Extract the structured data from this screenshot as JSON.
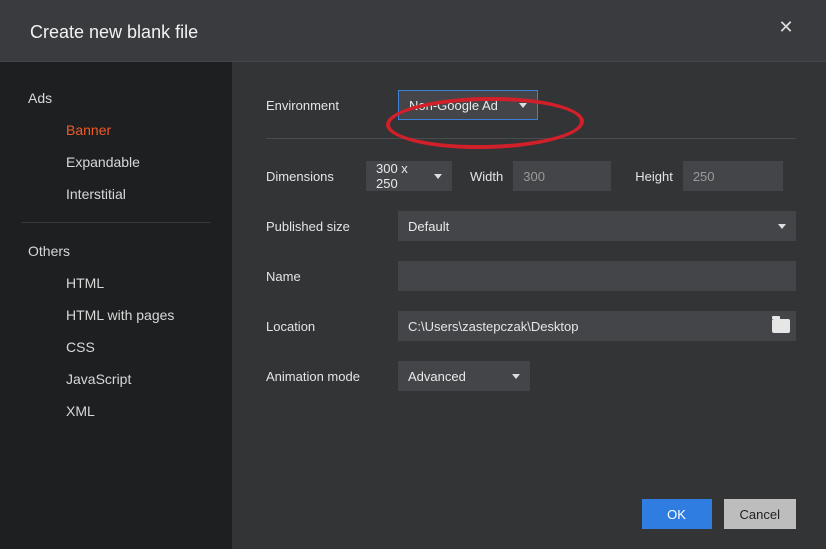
{
  "dialog": {
    "title": "Create new blank file"
  },
  "sidebar": {
    "group_ads": "Ads",
    "ads_items": [
      "Banner",
      "Expandable",
      "Interstitial"
    ],
    "group_others": "Others",
    "others_items": [
      "HTML",
      "HTML with pages",
      "CSS",
      "JavaScript",
      "XML"
    ],
    "selected": "Banner"
  },
  "form": {
    "environment_label": "Environment",
    "environment_value": "Non-Google Ad",
    "dimensions_label": "Dimensions",
    "dimensions_value": "300 x 250",
    "width_label": "Width",
    "width_value": "300",
    "height_label": "Height",
    "height_value": "250",
    "published_label": "Published size",
    "published_value": "Default",
    "name_label": "Name",
    "name_value": "",
    "location_label": "Location",
    "location_value": "C:\\Users\\zastepczak\\Desktop",
    "animation_label": "Animation mode",
    "animation_value": "Advanced"
  },
  "buttons": {
    "ok": "OK",
    "cancel": "Cancel"
  }
}
